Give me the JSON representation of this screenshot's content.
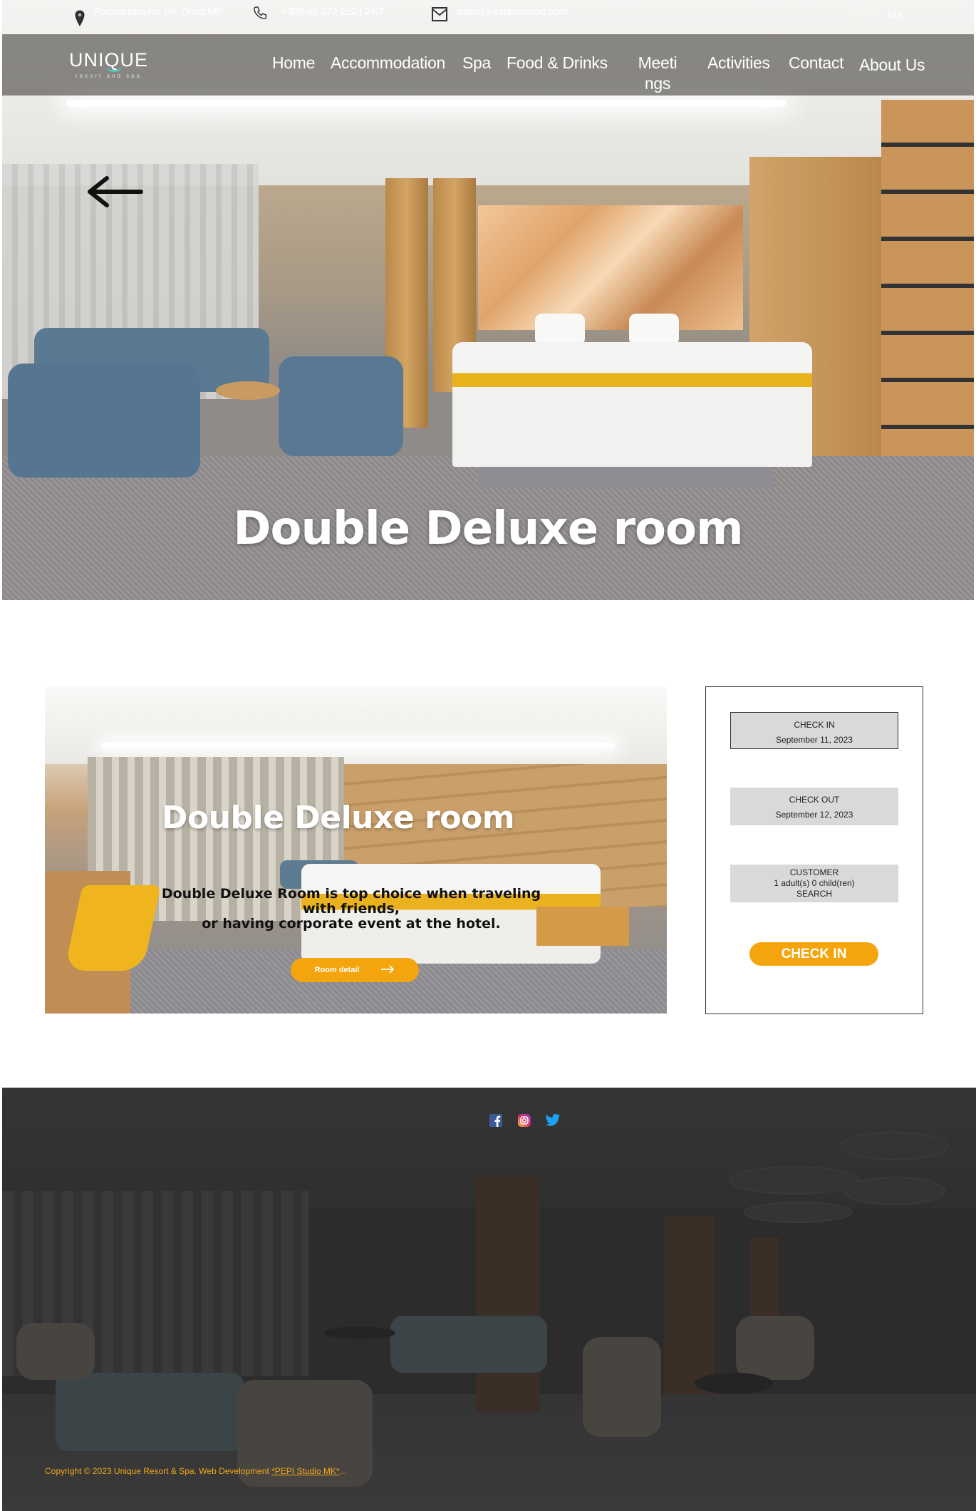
{
  "topbar": {
    "address": "Partizanska no. 56, Ohrid MK",
    "phone": "+389 46 272 222 | 24/7",
    "email": "sales@uniqueresort.com",
    "lang_en": "ENG",
    "lang_mk": "MK"
  },
  "logo": {
    "name": "UNIQUE",
    "tagline": "resort and spa"
  },
  "nav": {
    "home": "Home",
    "accommodation": "Accommodation",
    "spa": "Spa",
    "food": "Food & Drinks",
    "meetings_1": "Meeti",
    "meetings_2": "ngs",
    "activities": "Activities",
    "contact": "Contact",
    "about": "About Us"
  },
  "hero": {
    "title": "Double Deluxe room"
  },
  "room": {
    "title": "Double Deluxe room",
    "desc_line1": "Double Deluxe Room is top choice when traveling",
    "desc_line2": "with friends,",
    "desc_line3": "or having corporate event at the hotel.",
    "button": "Room detail"
  },
  "booking": {
    "checkin_label": "CHECK IN",
    "checkin_value": "September 11, 2023",
    "checkout_label": "CHECK OUT",
    "checkout_value": "September 12, 2023",
    "customer_label": "CUSTOMER",
    "customer_value": "1 adult(s) 0 child(ren)",
    "search_label": "SEARCH",
    "button": "CHECK IN"
  },
  "footer": {
    "copyright_prefix": "Copyright © 2023 Unique Resort & Spa. Web Development ",
    "developer_link": "*PEPI Studio MK*",
    "ellipsis": "..."
  },
  "icons": {
    "location": "location-pin-icon",
    "phone": "phone-icon",
    "email": "envelope-icon",
    "back": "arrow-left-icon",
    "facebook": "facebook-icon",
    "instagram": "instagram-icon",
    "twitter": "twitter-icon"
  },
  "colors": {
    "accent": "#f4a50d",
    "footer_bg": "#2c2c2c",
    "navbar_bg": "rgba(72,70,66,0.62)"
  }
}
